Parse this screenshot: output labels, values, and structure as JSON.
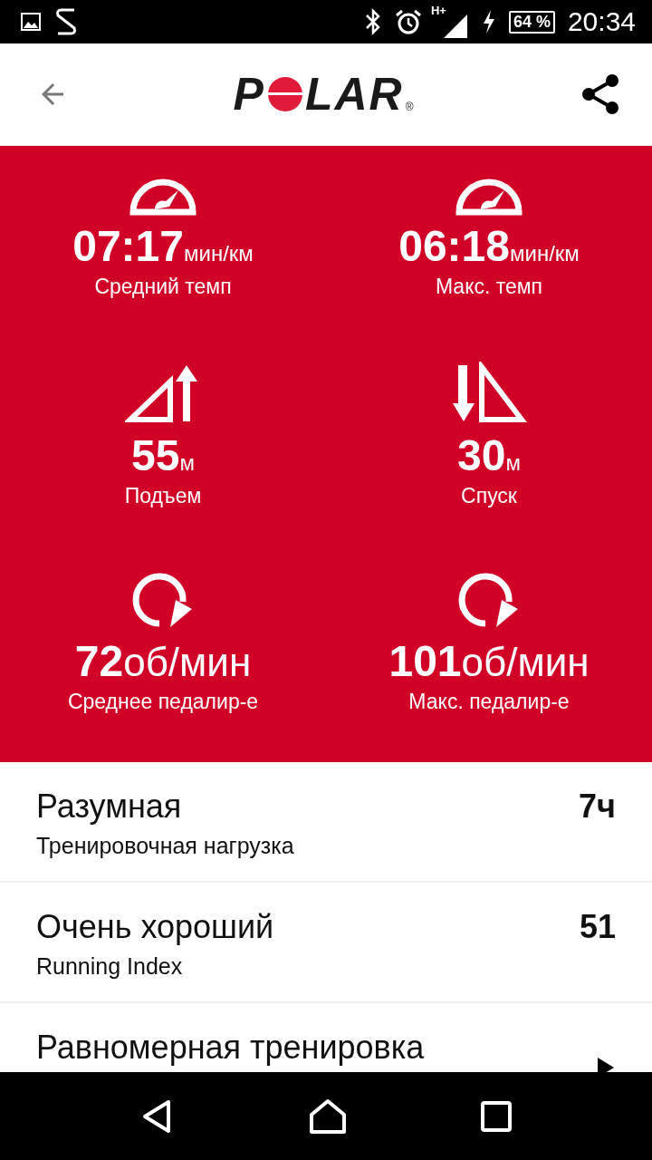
{
  "status_bar": {
    "network": "H+",
    "battery": "64 %",
    "time": "20:34"
  },
  "header": {
    "logo_start": "P",
    "logo_end": "LAR",
    "logo_mark": "®"
  },
  "metrics": [
    {
      "kind": "pace",
      "value": "07:17",
      "unit": "мин/км",
      "label": "Средний темп"
    },
    {
      "kind": "pace",
      "value": "06:18",
      "unit": "мин/км",
      "label": "Макс. темп"
    },
    {
      "kind": "ascent",
      "value": "55",
      "unit": "м",
      "label": "Подъем"
    },
    {
      "kind": "descent",
      "value": "30",
      "unit": "м",
      "label": "Спуск"
    },
    {
      "kind": "cadence",
      "value": "72",
      "unit": "об/мин",
      "label": "Среднее педалир-е"
    },
    {
      "kind": "cadence",
      "value": "101",
      "unit": "об/мин",
      "label": "Макс. педалир-е"
    }
  ],
  "rows": [
    {
      "title": "Разумная",
      "subtitle": "Тренировочная нагрузка",
      "value": "7ч"
    },
    {
      "title": "Очень хороший",
      "subtitle": "Running Index",
      "value": "51"
    },
    {
      "title": "Равномерная тренировка",
      "expandable": true
    }
  ]
}
